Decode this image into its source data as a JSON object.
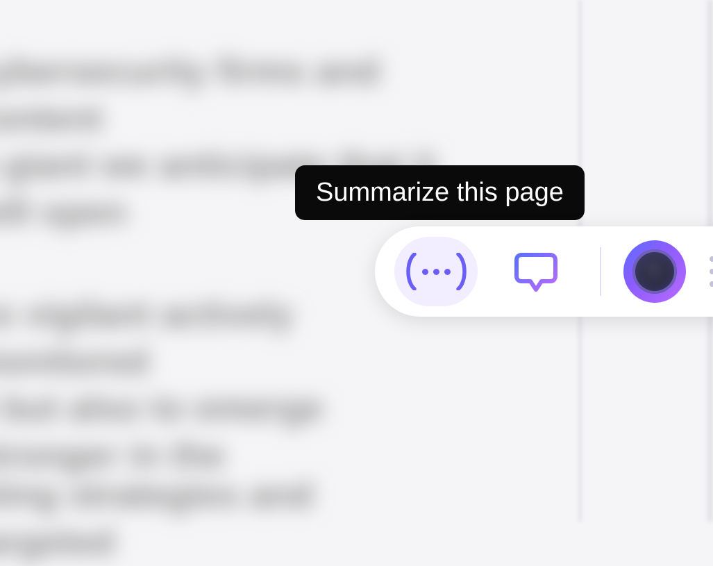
{
  "background": {
    "line1": "cybersecurity firms and content",
    "line2": "h giant we anticipate that it will open",
    "line3": "ns vigilant actively monitored",
    "line4": "e but also to emerge stronger in the",
    "line5": "eting strategies and targeted"
  },
  "tooltip": {
    "text": "Summarize this page"
  },
  "toolbar": {
    "summarize_button": "summarize",
    "chat_button": "chat",
    "assistant": "assistant"
  },
  "colors": {
    "accent_purple": "#6a5ef7",
    "accent_light_purple": "#f2eeff",
    "tooltip_bg": "#0a0a0a",
    "tooltip_text": "#ffffff",
    "orb_gradient_start": "#5a6fff",
    "orb_gradient_end": "#b96aff"
  }
}
